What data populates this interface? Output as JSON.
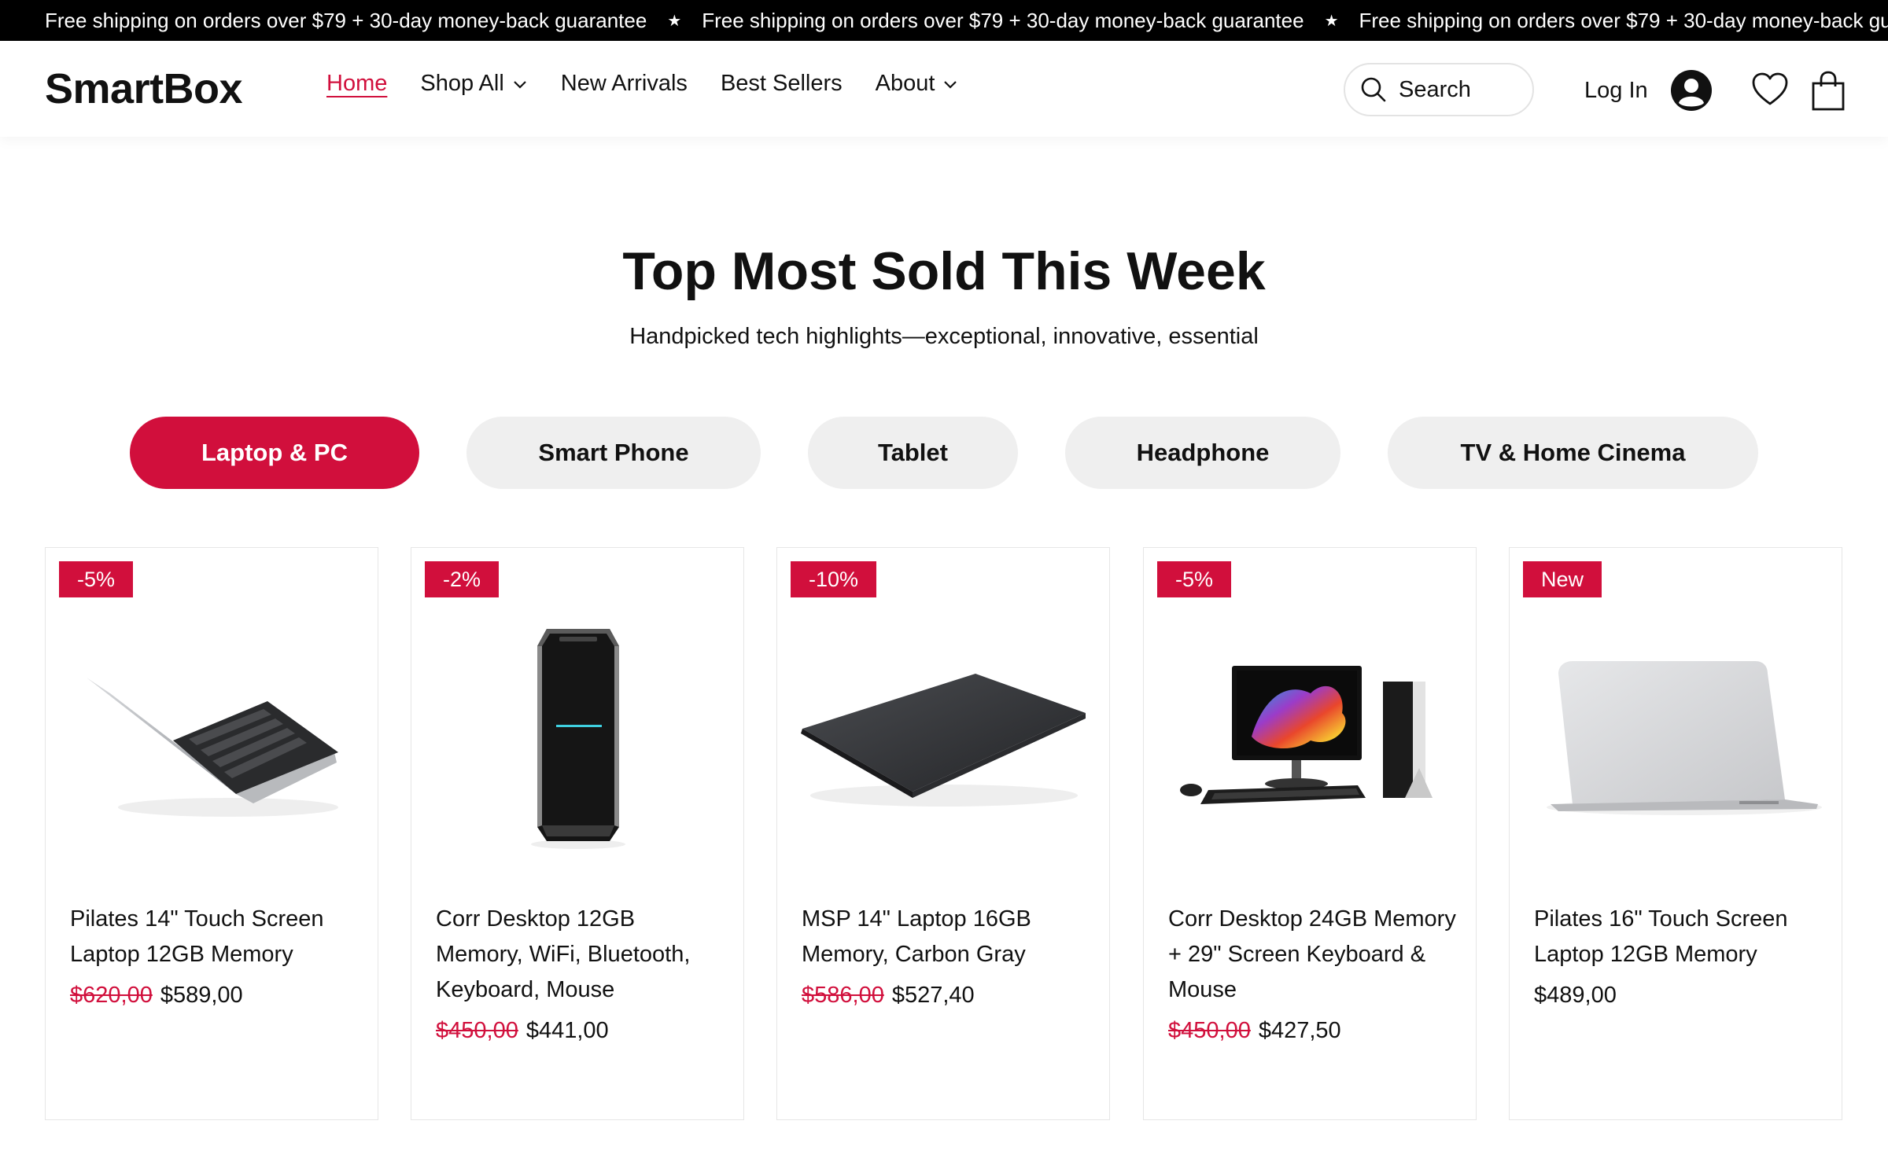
{
  "announcement": {
    "text": "Free shipping on orders over $79 + 30-day money-back guarantee",
    "separator": "★"
  },
  "header": {
    "logo": "SmartBox",
    "nav": [
      {
        "label": "Home",
        "active": true
      },
      {
        "label": "Shop All",
        "dropdown": true
      },
      {
        "label": "New Arrivals"
      },
      {
        "label": "Best Sellers"
      },
      {
        "label": "About",
        "dropdown": true
      }
    ],
    "search_label": "Search",
    "login_label": "Log In",
    "icons": [
      "search-icon",
      "account-icon",
      "heart-icon",
      "shopping-bag-icon"
    ]
  },
  "section": {
    "title": "Top Most Sold This Week",
    "subtitle": "Handpicked tech highlights—exceptional, innovative, essential"
  },
  "categories": [
    {
      "label": "Laptop & PC",
      "active": true
    },
    {
      "label": "Smart Phone"
    },
    {
      "label": "Tablet"
    },
    {
      "label": "Headphone"
    },
    {
      "label": "TV & Home Cinema"
    }
  ],
  "products": [
    {
      "badge": "-5%",
      "name": "Pilates 14\" Touch Screen Laptop 12GB Memory",
      "old_price": "$620,00",
      "price": "$589,00",
      "image": "open-laptop-image"
    },
    {
      "badge": "-2%",
      "name": "Corr Desktop 12GB Memory, WiFi, Bluetooth, Keyboard, Mouse",
      "old_price": "$450,00",
      "price": "$441,00",
      "image": "desktop-tower-image"
    },
    {
      "badge": "-10%",
      "name": "MSP 14\" Laptop 16GB Memory, Carbon Gray",
      "old_price": "$586,00",
      "price": "$527,40",
      "image": "closed-laptop-image"
    },
    {
      "badge": "-5%",
      "name": "Corr Desktop 24GB Memory + 29\" Screen Keyboard & Mouse",
      "old_price": "$450,00",
      "price": "$427,50",
      "image": "desktop-set-image"
    },
    {
      "badge": "New",
      "name": "Pilates 16\" Touch Screen Laptop 12GB Memory",
      "old_price": "",
      "price": "$489,00",
      "image": "silver-laptop-image"
    }
  ],
  "colors": {
    "accent": "#d10f3c",
    "pill_bg": "#efefef",
    "announce_bg": "#000000"
  }
}
